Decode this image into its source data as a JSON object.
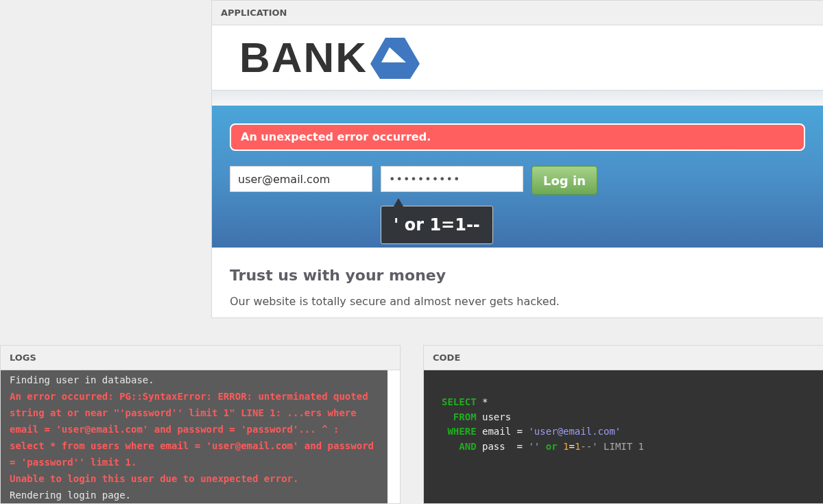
{
  "application": {
    "title": "APPLICATION",
    "logo_text": "BANK",
    "error": "An unexpected error occurred.",
    "email": {
      "value": "user@email.com"
    },
    "password": {
      "value": "••••••••••"
    },
    "login_button": "Log in",
    "tooltip": "' or 1=1--",
    "heading": "Trust us with your money",
    "text": "Our website is totally secure and almost never gets hacked."
  },
  "logs": {
    "title": "LOGS",
    "lines": [
      {
        "kind": "info",
        "text": "Finding user in database."
      },
      {
        "kind": "error",
        "text": "An error occurred: PG::SyntaxError: ERROR: unterminated quoted string at or near \"'password'' limit 1\" LINE 1: ...ers where email = 'user@email.com' and password = 'password'... ^ : select * from users where email = 'user@email.com' and password = 'password'' limit 1."
      },
      {
        "kind": "error",
        "text": "Unable to login this user due to unexpected error."
      },
      {
        "kind": "info",
        "text": "Rendering login page."
      }
    ]
  },
  "code": {
    "title": "CODE",
    "lines": [
      [
        {
          "kind": "keyword",
          "text": "SELECT"
        },
        {
          "kind": "plain",
          "text": " *"
        }
      ],
      [
        {
          "kind": "keyword",
          "text": "  FROM"
        },
        {
          "kind": "plain",
          "text": " users"
        }
      ],
      [
        {
          "kind": "keyword",
          "text": " WHERE"
        },
        {
          "kind": "plain",
          "text": " email = "
        },
        {
          "kind": "string",
          "text": "'user@email.com'"
        }
      ],
      [
        {
          "kind": "keyword",
          "text": "   AND"
        },
        {
          "kind": "plain",
          "text": " pass  = "
        },
        {
          "kind": "string",
          "text": "''"
        },
        {
          "kind": "keyword",
          "text": " or"
        },
        {
          "kind": "number",
          "text": " 1"
        },
        {
          "kind": "plain",
          "text": "="
        },
        {
          "kind": "number",
          "text": "1"
        },
        {
          "kind": "comment",
          "text": "--' LIMIT 1"
        }
      ]
    ]
  }
}
